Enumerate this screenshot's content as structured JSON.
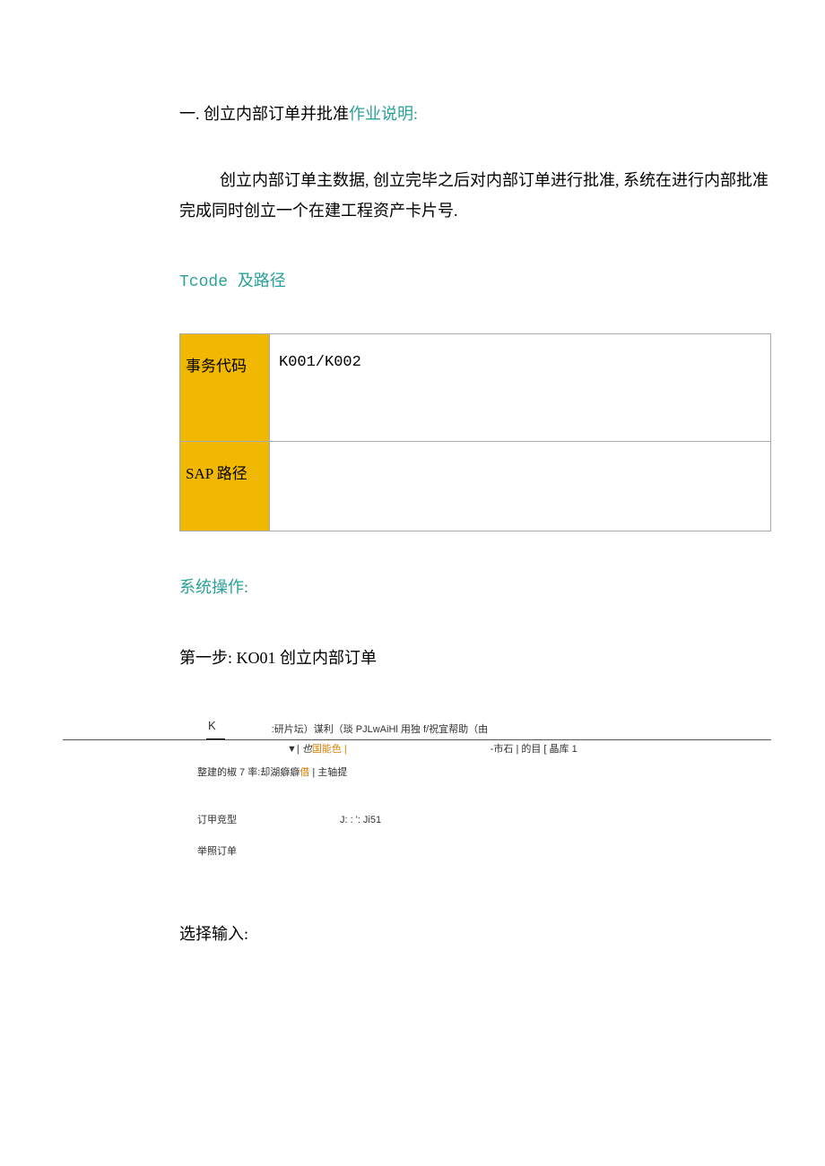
{
  "section_title": {
    "prefix": "一. 创立内部订单并批准",
    "suffix": "作业说明:"
  },
  "paragraph": "创立内部订单主数据, 创立完毕之后对内部订单进行批准, 系统在进行内部批准完成同时创立一个在建工程资产卡片号.",
  "tcode_heading": "Tcode 及路径",
  "table": {
    "row1_label": "事务代码",
    "row1_value": "K001/K002",
    "row2_label": "SAP 路径",
    "row2_value": ""
  },
  "system_op": "系统操作:",
  "step1": "第一步: KO01 创立内部订单",
  "ui": {
    "k": "K",
    "menu": ":研片坛）谋利（琰 PJLwAiHl 用独 f/祝宜帮助（由",
    "toolbar_left_tri": "▼| ",
    "toolbar_left_ital": "也",
    "toolbar_left_rest": "国能色 |",
    "toolbar_right": "-市石 | 的目 [ 晶库 1",
    "line3_pre": "整建的椒 7 率:却湖癖癖",
    "line3_orange": "借",
    "line3_post": "  | 主轴提",
    "order_type_label": "订甲竞型",
    "order_type_value": "J:  :  ':  Ji51",
    "ref_order_label": "举照订单"
  },
  "select_input": "选择输入:"
}
